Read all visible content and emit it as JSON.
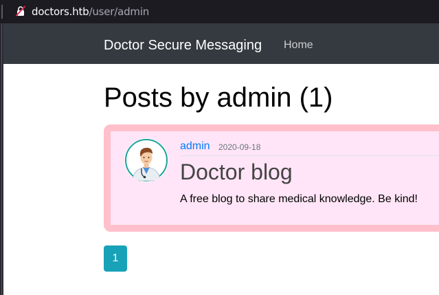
{
  "browser": {
    "url_host": "doctors.htb",
    "url_path": "/user/admin"
  },
  "navbar": {
    "brand": "Doctor Secure Messaging",
    "links": [
      {
        "label": "Home"
      }
    ]
  },
  "page": {
    "title": "Posts by admin (1)"
  },
  "posts": [
    {
      "author": "admin",
      "date": "2020-09-18",
      "title": "Doctor blog",
      "content": "A free blog to share medical knowledge. Be kind!",
      "avatar_icon": "doctor-avatar-icon"
    }
  ],
  "pagination": {
    "pages": [
      "1"
    ],
    "active_color": "#17a2b8"
  },
  "colors": {
    "navbar_bg": "#343a40",
    "card_bg": "#ffe5f7",
    "card_border": "#ffc0cb",
    "link": "#007bff"
  }
}
